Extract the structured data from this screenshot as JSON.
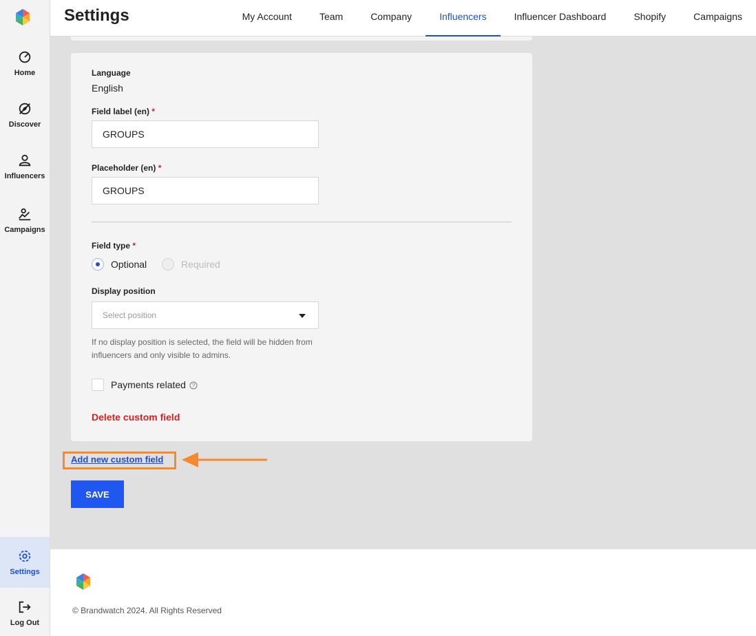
{
  "sidebar": {
    "items": [
      {
        "label": "Home",
        "icon": "dashboard-gauge-icon"
      },
      {
        "label": "Discover",
        "icon": "compass-icon"
      },
      {
        "label": "Influencers",
        "icon": "user-icon"
      },
      {
        "label": "Campaigns",
        "icon": "chart-icon"
      },
      {
        "label": "Settings",
        "icon": "gear-icon"
      },
      {
        "label": "Log Out",
        "icon": "logout-icon"
      }
    ],
    "active_item": "Settings"
  },
  "header": {
    "title": "Settings",
    "tabs": [
      {
        "label": "My Account"
      },
      {
        "label": "Team"
      },
      {
        "label": "Company"
      },
      {
        "label": "Influencers"
      },
      {
        "label": "Influencer Dashboard"
      },
      {
        "label": "Shopify"
      },
      {
        "label": "Campaigns"
      }
    ],
    "active_tab": "Influencers"
  },
  "form": {
    "language_label": "Language",
    "language_value": "English",
    "field_label_label": "Field label (en)",
    "field_label_value": "GROUPS",
    "placeholder_label": "Placeholder (en)",
    "placeholder_value": "GROUPS",
    "required_mark": "*",
    "field_type_label": "Field type",
    "field_type_options": [
      {
        "label": "Optional",
        "selected": true
      },
      {
        "label": "Required",
        "selected": false
      }
    ],
    "display_position_label": "Display position",
    "display_position_placeholder": "Select position",
    "display_position_hint": "If no display position is selected, the field will be hidden from influencers and only visible to admins.",
    "payments_related_label": "Payments related",
    "payments_related_checked": false,
    "delete_label": "Delete custom field"
  },
  "actions": {
    "add_custom_field_label": "Add new custom field",
    "save_label": "SAVE"
  },
  "footer": {
    "copyright": "© Brandwatch 2024. All Rights Reserved"
  },
  "colors": {
    "accent": "#1d4ed8",
    "danger": "#d71f1f",
    "highlight": "#f5892b",
    "save_button": "#1f57f0"
  }
}
